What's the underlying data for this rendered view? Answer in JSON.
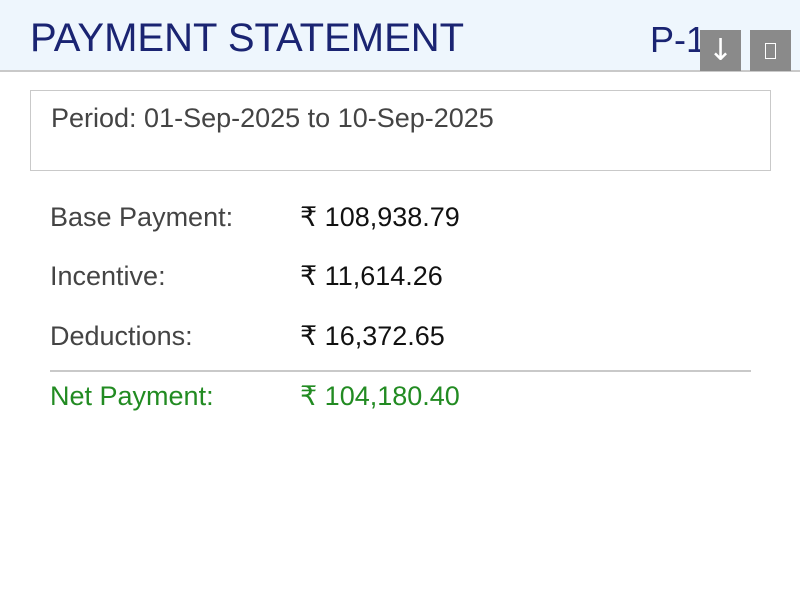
{
  "header": {
    "title": "PAYMENT STATEMENT",
    "page_code": "P-1",
    "download_icon_glyph": "↓",
    "download_icon_name": "download-icon",
    "extra_icon_name": "missing-glyph-icon"
  },
  "period": {
    "text": "Period: 01-Sep-2025 to 10-Sep-2025"
  },
  "rows": [
    {
      "label": "Base Payment:",
      "value": "₹ 108,938.79"
    },
    {
      "label": "Incentive:",
      "value": "₹ 11,614.26"
    },
    {
      "label": "Deductions:",
      "value": "₹ 16,372.65"
    }
  ],
  "net": {
    "label": "Net Payment:",
    "value": "₹ 104,180.40"
  },
  "colors": {
    "header_background": "#eef6fd",
    "title": "#1a2472",
    "net_payment": "#228b22",
    "button_background": "#8a8a8a",
    "divider": "#c9c9c9"
  }
}
